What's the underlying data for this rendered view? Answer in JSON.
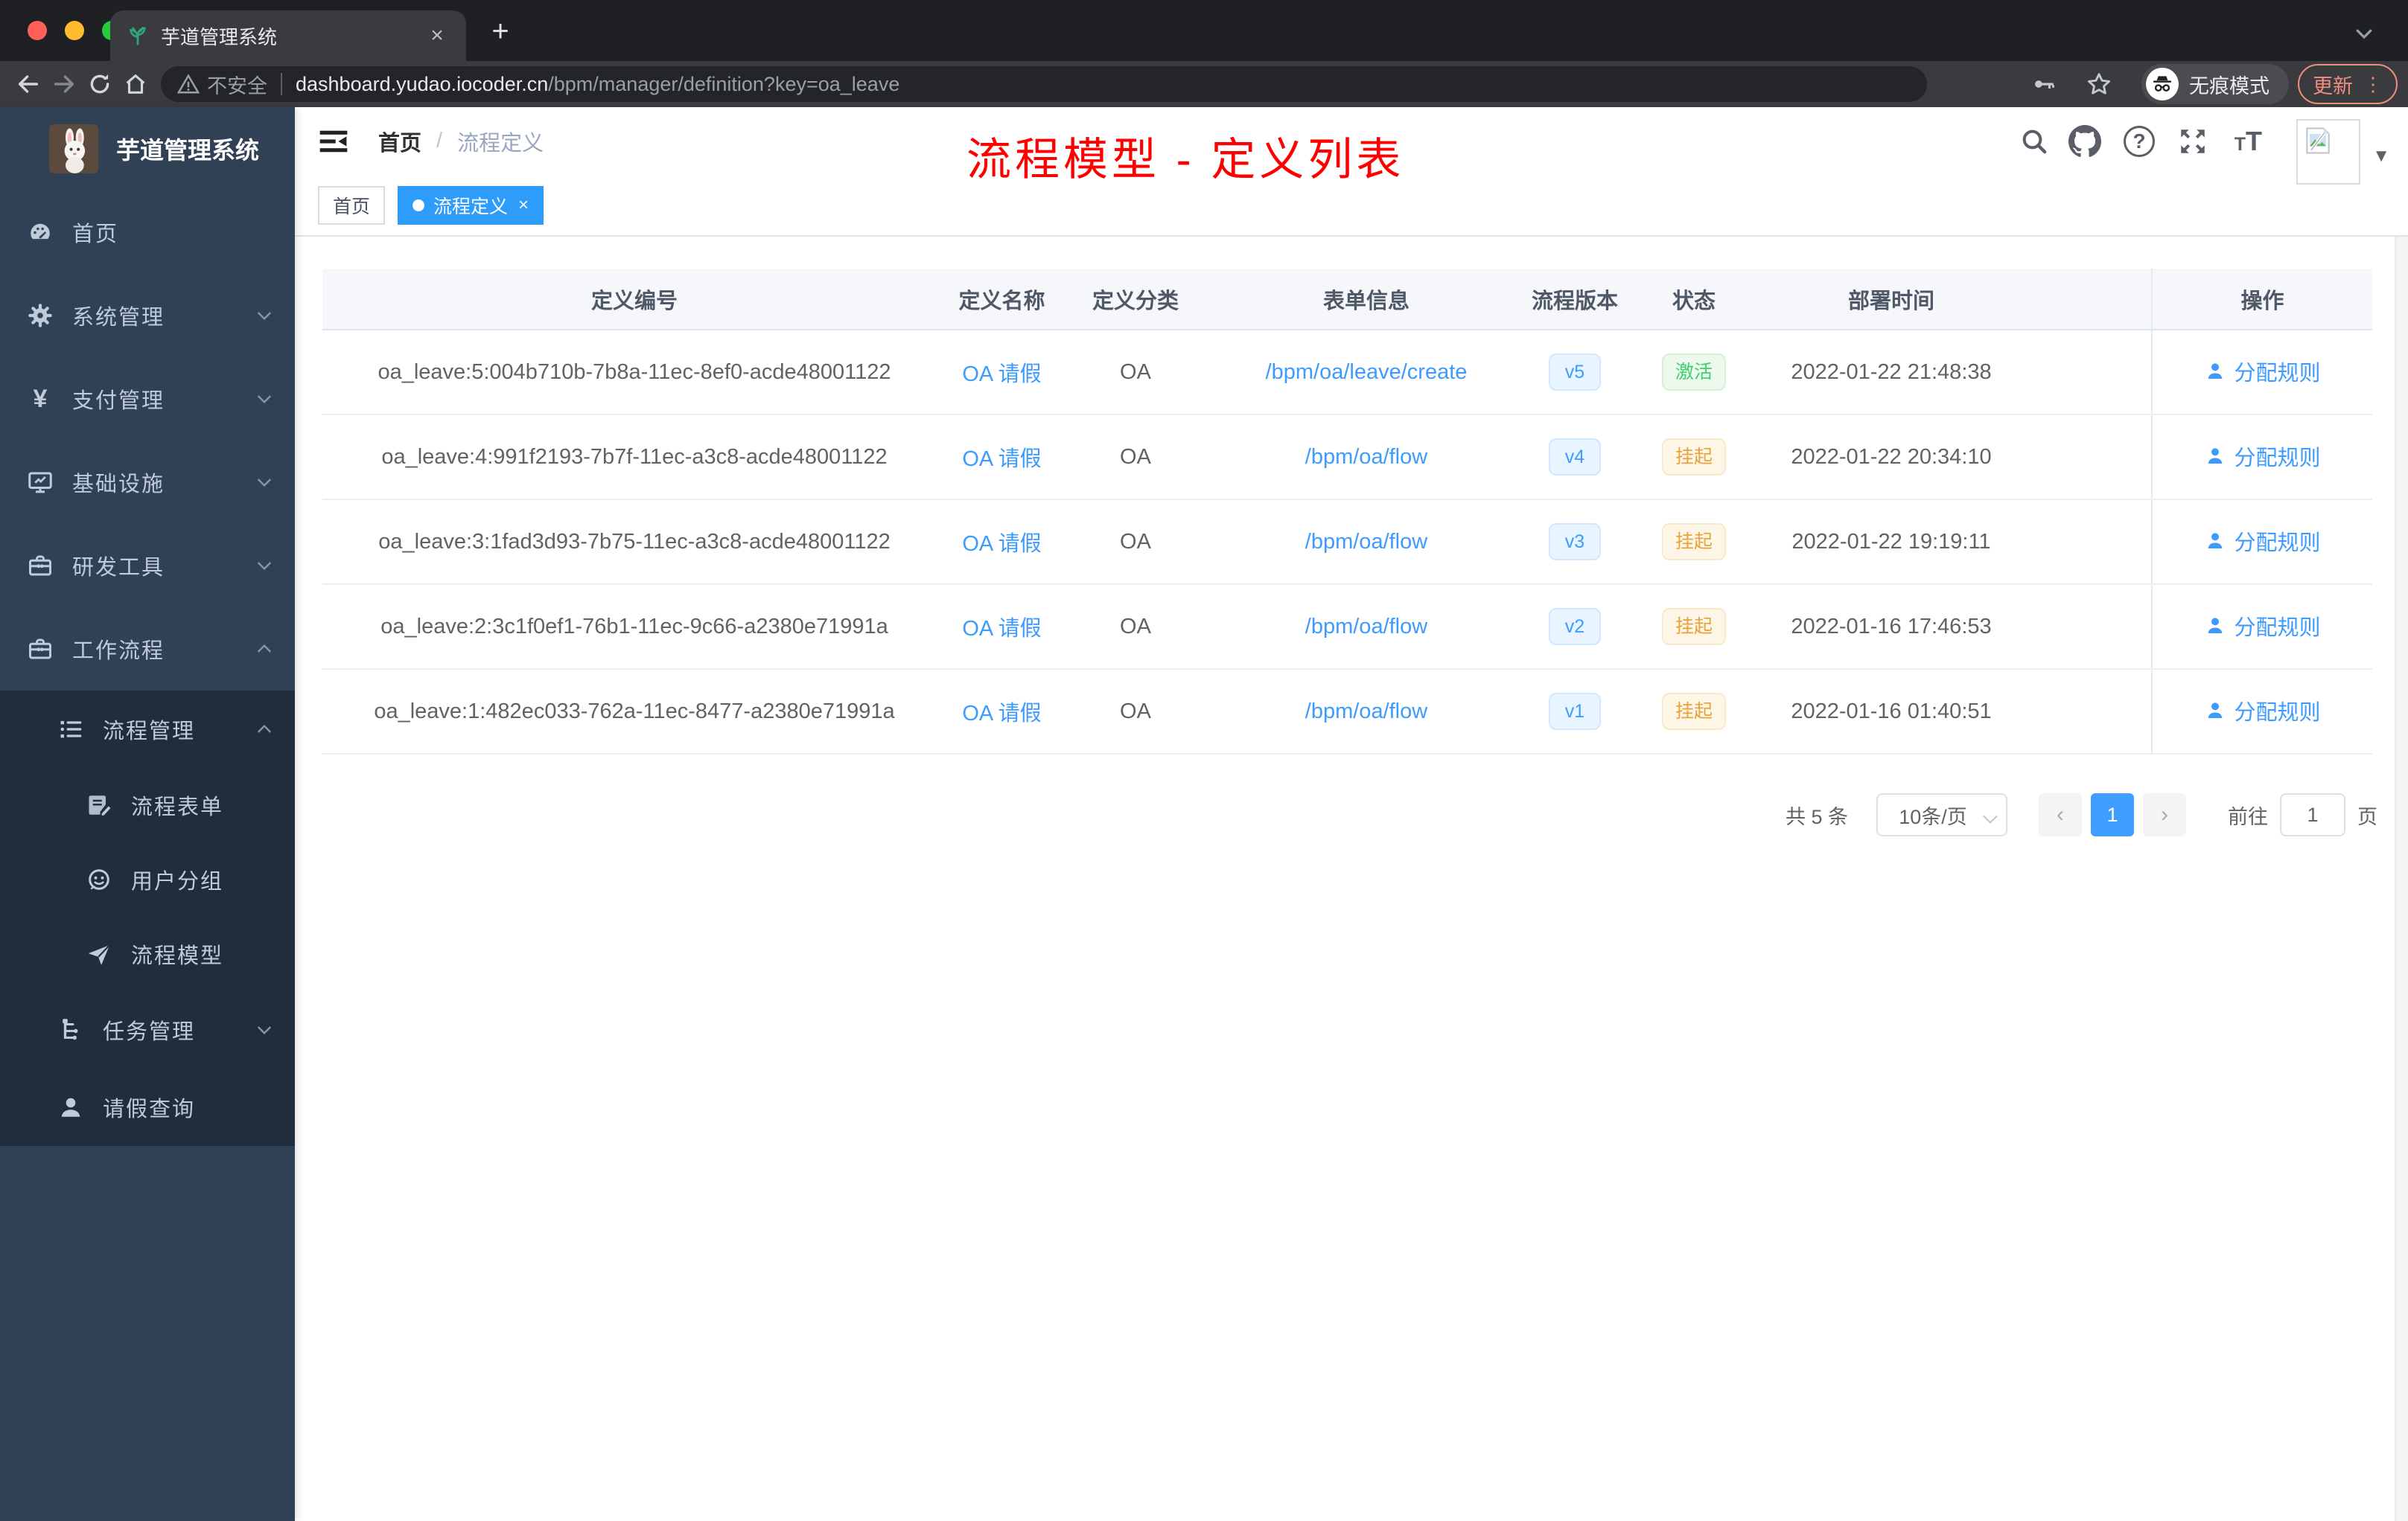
{
  "browser": {
    "tab_title": "芋道管理系统",
    "new_tab_symbol": "+",
    "close_symbol": "×",
    "url_security": "不安全",
    "url_domain": "dashboard.yudao.iocoder.cn",
    "url_path": "/bpm/manager/definition?key=oa_leave",
    "incognito_label": "无痕模式",
    "update_label": "更新",
    "kebab_symbol": "⋮"
  },
  "sidebar": {
    "logo_title": "芋道管理系统",
    "items": [
      {
        "label": "首页"
      },
      {
        "label": "系统管理"
      },
      {
        "label": "支付管理"
      },
      {
        "label": "基础设施"
      },
      {
        "label": "研发工具"
      },
      {
        "label": "工作流程"
      },
      {
        "label": "流程管理"
      },
      {
        "label": "流程表单"
      },
      {
        "label": "用户分组"
      },
      {
        "label": "流程模型"
      },
      {
        "label": "任务管理"
      },
      {
        "label": "请假查询"
      }
    ]
  },
  "header": {
    "breadcrumb_home": "首页",
    "breadcrumb_sep": "/",
    "breadcrumb_current": "流程定义",
    "help_glyph": "?",
    "caret_glyph": "▼"
  },
  "annotation": {
    "text": "流程模型 - 定义列表",
    "color": "#fe0000"
  },
  "tags": {
    "home": "首页",
    "active": "流程定义",
    "active_close": "×"
  },
  "table": {
    "headers": [
      "定义编号",
      "定义名称",
      "定义分类",
      "表单信息",
      "流程版本",
      "状态",
      "部署时间",
      "操作"
    ],
    "rows": [
      {
        "id": "oa_leave:5:004b710b-7b8a-11ec-8ef0-acde48001122",
        "name": "OA 请假",
        "category": "OA",
        "form": "/bpm/oa/leave/create",
        "version": "v5",
        "status": "激活",
        "time": "2022-01-22 21:48:38",
        "action": "分配规则"
      },
      {
        "id": "oa_leave:4:991f2193-7b7f-11ec-a3c8-acde48001122",
        "name": "OA 请假",
        "category": "OA",
        "form": "/bpm/oa/flow",
        "version": "v4",
        "status": "挂起",
        "time": "2022-01-22 20:34:10",
        "action": "分配规则"
      },
      {
        "id": "oa_leave:3:1fad3d93-7b75-11ec-a3c8-acde48001122",
        "name": "OA 请假",
        "category": "OA",
        "form": "/bpm/oa/flow",
        "version": "v3",
        "status": "挂起",
        "time": "2022-01-22 19:19:11",
        "action": "分配规则"
      },
      {
        "id": "oa_leave:2:3c1f0ef1-76b1-11ec-9c66-a2380e71991a",
        "name": "OA 请假",
        "category": "OA",
        "form": "/bpm/oa/flow",
        "version": "v2",
        "status": "挂起",
        "time": "2022-01-16 17:46:53",
        "action": "分配规则"
      },
      {
        "id": "oa_leave:1:482ec033-762a-11ec-8477-a2380e71991a",
        "name": "OA 请假",
        "category": "OA",
        "form": "/bpm/oa/flow",
        "version": "v1",
        "status": "挂起",
        "time": "2022-01-16 01:40:51",
        "action": "分配规则"
      }
    ]
  },
  "pagination": {
    "total": "共 5 条",
    "page_size": "10条/页",
    "prev_symbol": "‹",
    "current_page": "1",
    "next_symbol": "›",
    "goto_label": "前往",
    "goto_value": "1",
    "page_unit": "页"
  },
  "colors": {
    "accent_blue": "#409eff",
    "tag_active": "#2d9cfa",
    "status_active": "#3ecf72",
    "status_suspended": "#e6a23c",
    "sidebar_bg": "#304156",
    "submenu_bg": "#1f2d3d",
    "annotation_red": "#fe0000"
  }
}
